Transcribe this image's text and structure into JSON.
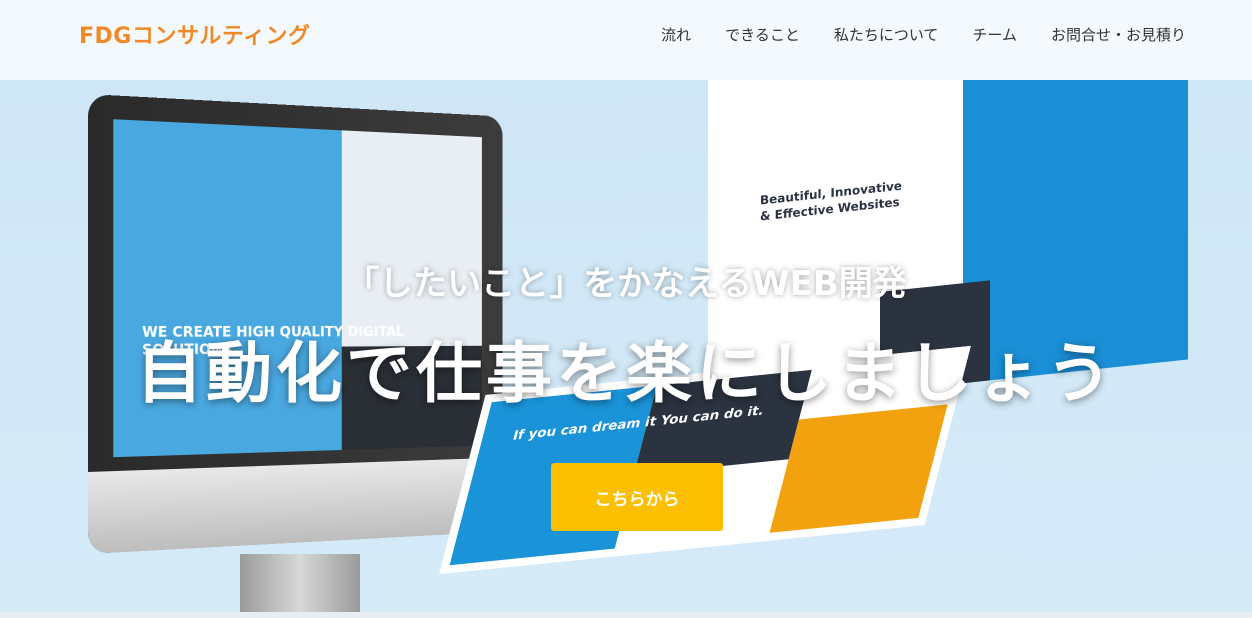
{
  "nav": {
    "brand": "FDGコンサルティング",
    "items": [
      "流れ",
      "できること",
      "私たちについて",
      "チーム",
      "お問合せ・お見積り"
    ]
  },
  "hero": {
    "tagline": "「したいこと」をかなえるWEB開発",
    "headline": "自動化で仕事を楽にしましょう",
    "cta_label": "こちらから",
    "illustration": {
      "monitor_text": "WE CREATE HIGH QUALITY DIGITAL SOLUTIONS",
      "panel_text": "Beautiful, Innovative & Effective Websites",
      "tablet_text": "If you can dream it You can do it."
    }
  },
  "colors": {
    "brand": "#f08a28",
    "cta": "#fcc000",
    "hero_bg": "#d3e9f7"
  }
}
